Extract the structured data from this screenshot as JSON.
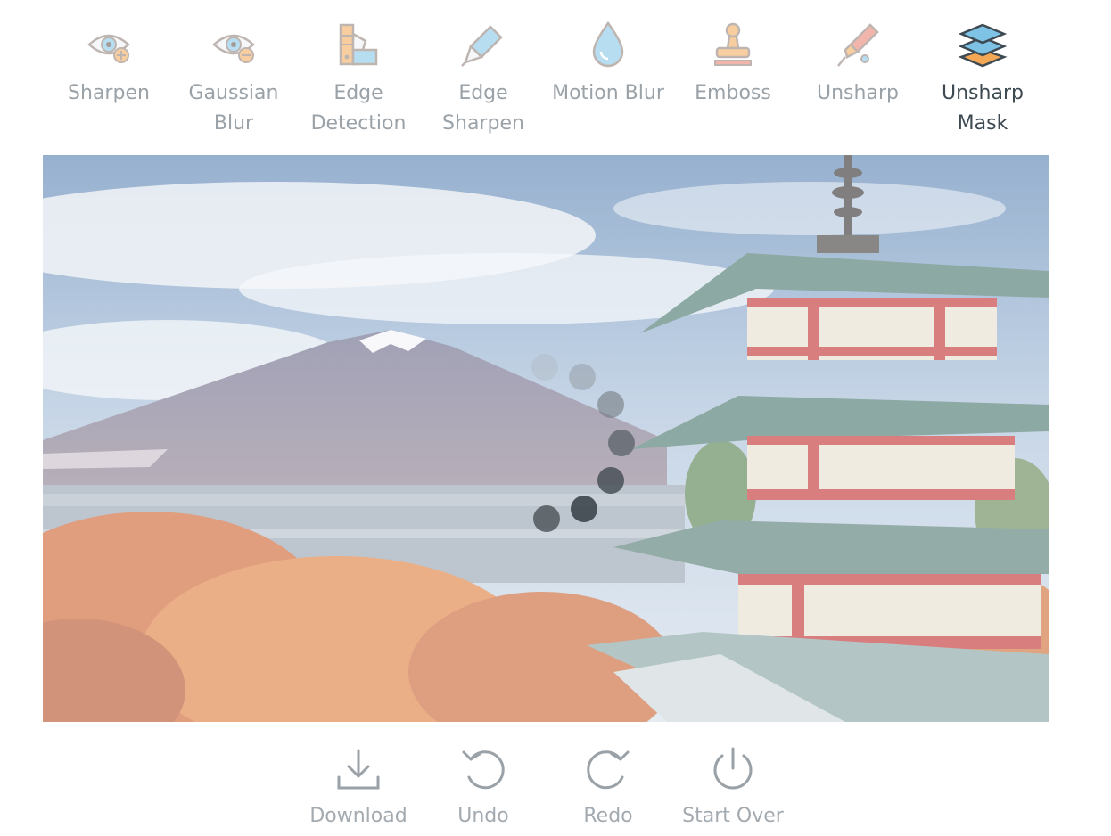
{
  "filters": [
    {
      "label": "Sharpen",
      "icon": "eye-plus-icon"
    },
    {
      "label": "Gaussian Blur",
      "icon": "eye-minus-icon"
    },
    {
      "label": "Edge Detection",
      "icon": "swatches-icon"
    },
    {
      "label": "Edge Sharpen",
      "icon": "scalpel-icon"
    },
    {
      "label": "Motion Blur",
      "icon": "droplet-icon"
    },
    {
      "label": "Emboss",
      "icon": "stamp-icon"
    },
    {
      "label": "Unsharp",
      "icon": "pen-tool-icon"
    },
    {
      "label": "Unsharp Mask",
      "icon": "layers-icon"
    }
  ],
  "selected_filter": "Unsharp Mask",
  "actions": [
    {
      "label": "Download",
      "icon": "download-icon"
    },
    {
      "label": "Undo",
      "icon": "undo-icon"
    },
    {
      "label": "Redo",
      "icon": "redo-icon"
    },
    {
      "label": "Start Over",
      "icon": "power-icon"
    }
  ],
  "colors": {
    "icon_stroke": "#8a7a72",
    "icon_blue": "#7ec3e6",
    "icon_orange": "#f4a754",
    "label": "#9aa2a8",
    "label_active": "#3d4a52",
    "action": "#a3aab0"
  }
}
